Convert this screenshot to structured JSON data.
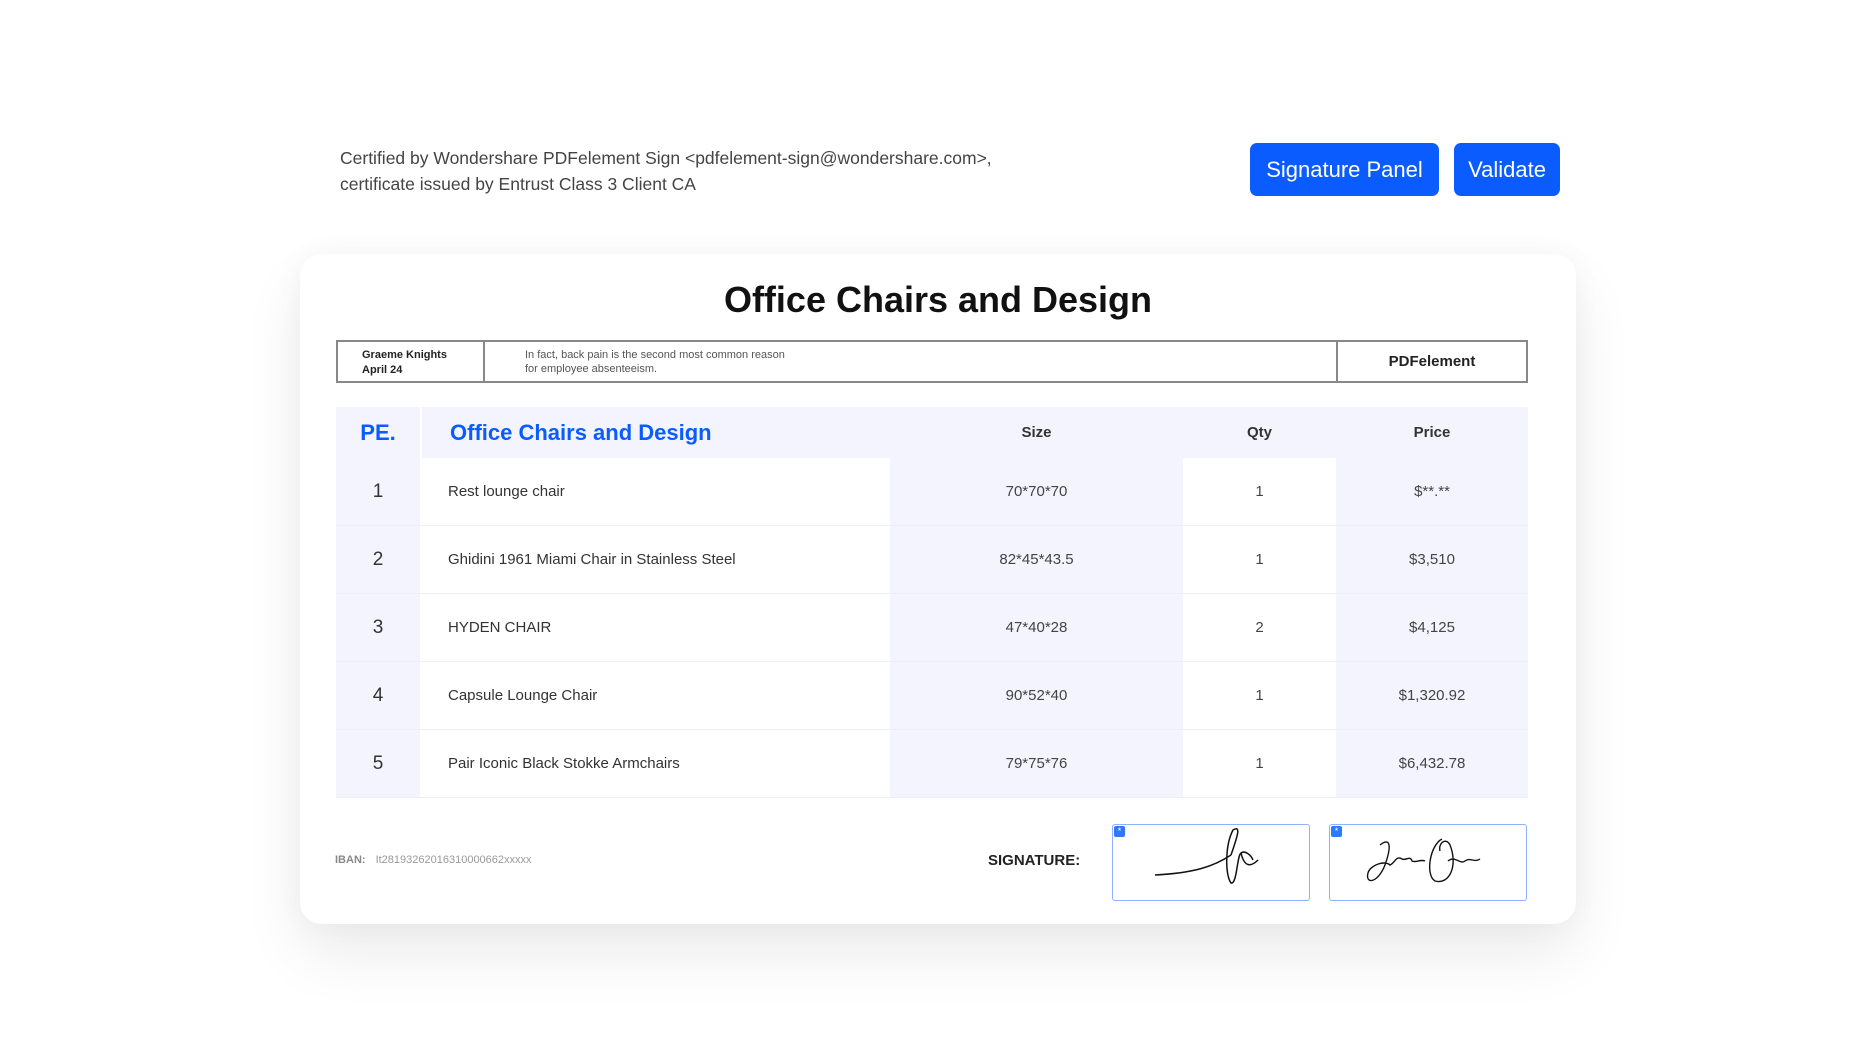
{
  "certificate": {
    "line1": "Certified by Wondershare PDFelement Sign <pdfelement-sign@wondershare.com>,",
    "line2": "certificate issued by Entrust Class 3 Client CA"
  },
  "buttons": {
    "signature_panel": "Signature Panel",
    "validate": "Validate"
  },
  "document": {
    "title": "Office Chairs and Design",
    "info": {
      "author": "Graeme Knights",
      "date": "April 24",
      "note_line1": "In fact, back pain is the second most common reason",
      "note_line2": "for employee absenteeism.",
      "brand": "PDFelement"
    },
    "table": {
      "headers": {
        "logo": "PE.",
        "name": "Office Chairs and Design",
        "size": "Size",
        "qty": "Qty",
        "price": "Price"
      },
      "rows": [
        {
          "no": "1",
          "name": "Rest lounge chair",
          "size": "70*70*70",
          "qty": "1",
          "price": "$**.**"
        },
        {
          "no": "2",
          "name": "Ghidini 1961 Miami Chair in Stainless Steel",
          "size": "82*45*43.5",
          "qty": "1",
          "price": "$3,510"
        },
        {
          "no": "3",
          "name": "HYDEN CHAIR",
          "size": "47*40*28",
          "qty": "2",
          "price": "$4,125"
        },
        {
          "no": "4",
          "name": "Capsule Lounge Chair",
          "size": "90*52*40",
          "qty": "1",
          "price": "$1,320.92"
        },
        {
          "no": "5",
          "name": "Pair Iconic Black Stokke Armchairs",
          "size": "79*75*76",
          "qty": "1",
          "price": "$6,432.78"
        }
      ]
    },
    "footer": {
      "iban_label": "IBAN:",
      "iban_value": "It28193262016310000662xxxxx",
      "signature_label": "SIGNATURE:"
    }
  },
  "colors": {
    "accent": "#0a5cff",
    "table_tint": "#f3f4fd"
  }
}
